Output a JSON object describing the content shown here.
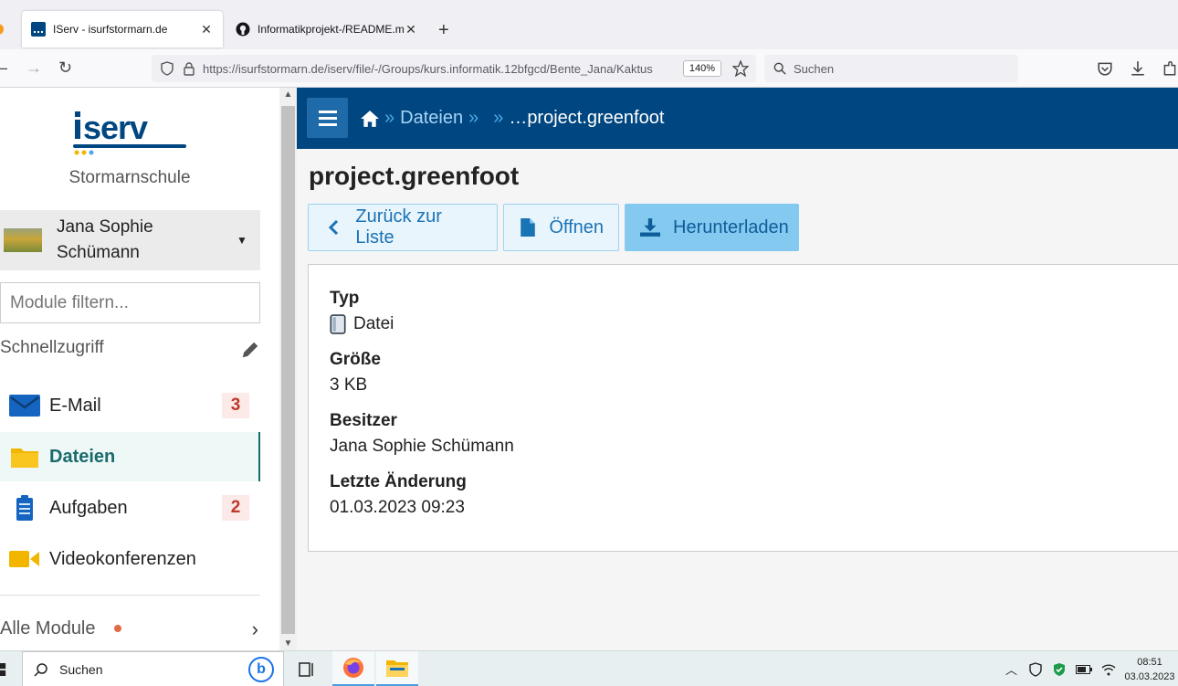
{
  "browser": {
    "tabs": [
      {
        "title": "IServ - isurfstormarn.de",
        "close": "✕"
      },
      {
        "title": "Informatikprojekt-/README.md",
        "close": "✕"
      }
    ],
    "new_tab": "+",
    "url_host": "https://isurfstormarn.de",
    "url_path": "/iserv/file/-/Groups/kurs.informatik.12bfgcd/Bente_Jana/Kaktus",
    "zoom": "140%",
    "search_placeholder": "Suchen"
  },
  "sidebar": {
    "school": "Stormarnschule",
    "user_first": "Jana Sophie",
    "user_last": "Schümann",
    "filter_placeholder": "Module filtern...",
    "quick_access": "Schnellzugriff",
    "items": [
      {
        "label": "E-Mail",
        "badge": "3",
        "icon": "mail-icon"
      },
      {
        "label": "Dateien",
        "badge": "",
        "icon": "folder-icon",
        "active": true
      },
      {
        "label": "Aufgaben",
        "badge": "2",
        "icon": "clipboard-icon"
      },
      {
        "label": "Videokonferenzen",
        "badge": "",
        "icon": "video-icon"
      }
    ],
    "all_modules": "Alle Module"
  },
  "header": {
    "breadcrumb_files": "Dateien",
    "breadcrumb_current": "…project.greenfoot"
  },
  "main": {
    "title": "project.greenfoot",
    "buttons": {
      "back": "Zurück zur Liste",
      "open": "Öffnen",
      "download": "Herunterladen"
    },
    "fields": {
      "type_label": "Typ",
      "type_value": "Datei",
      "size_label": "Größe",
      "size_value": "3 KB",
      "owner_label": "Besitzer",
      "owner_value": "Jana Sophie Schümann",
      "modified_label": "Letzte Änderung",
      "modified_value": "01.03.2023 09:23"
    }
  },
  "taskbar": {
    "search": "Suchen",
    "time": "08:51",
    "date": "03.03.2023"
  },
  "colors": {
    "header": "#004680",
    "accent": "#1a73b5",
    "active_nav": "#1a6b6b",
    "badge": "#c0392b"
  }
}
